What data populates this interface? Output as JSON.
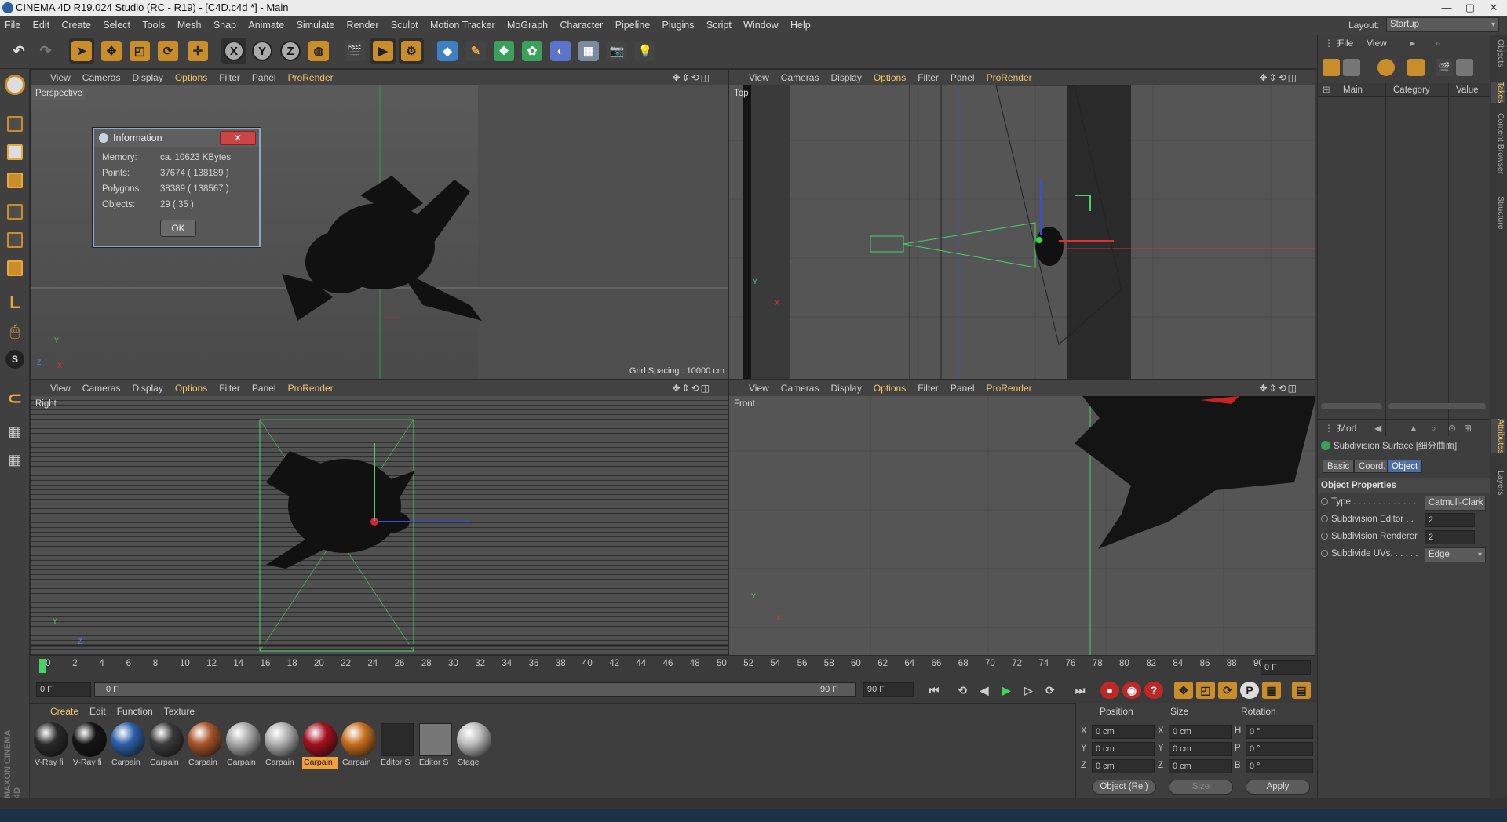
{
  "window": {
    "title": "CINEMA 4D R19.024 Studio (RC - R19) - [C4D.c4d *] - Main",
    "minimize": "—",
    "maximize": "▢",
    "close": "✕"
  },
  "menu": {
    "items": [
      "File",
      "Edit",
      "Create",
      "Select",
      "Tools",
      "Mesh",
      "Snap",
      "Animate",
      "Simulate",
      "Render",
      "Sculpt",
      "Motion Tracker",
      "MoGraph",
      "Character",
      "Pipeline",
      "Plugins",
      "Script",
      "Window",
      "Help"
    ]
  },
  "layout": {
    "label": "Layout:",
    "value": "Startup"
  },
  "toolbar": {
    "axis_x": "X",
    "axis_y": "Y",
    "axis_z": "Z"
  },
  "viewports": {
    "menu": [
      "View",
      "Cameras",
      "Display",
      "Options",
      "Filter",
      "Panel",
      "ProRender"
    ],
    "nav_icons": "✥⇕⟲◫",
    "perspective": {
      "name": "Perspective",
      "grid_spacing": "Grid Spacing : 10000 cm"
    },
    "top": {
      "name": "Top"
    },
    "right": {
      "name": "Right"
    },
    "front": {
      "name": "Front"
    },
    "axis_y": "Y",
    "axis_x": "X",
    "axis_z": "Z"
  },
  "info_dialog": {
    "title": "Information",
    "close_label": "✕",
    "rows": [
      {
        "key": "Memory:",
        "value": "ca. 10623 KBytes"
      },
      {
        "key": "Points:",
        "value": "37674 ( 138189 )"
      },
      {
        "key": "Polygons:",
        "value": "38389 ( 138567 )"
      },
      {
        "key": "Objects:",
        "value": "29 ( 35 )"
      }
    ],
    "ok_label": "OK"
  },
  "timeline": {
    "ticks": [
      "0",
      "2",
      "4",
      "6",
      "8",
      "10",
      "12",
      "14",
      "16",
      "18",
      "20",
      "22",
      "24",
      "26",
      "28",
      "30",
      "32",
      "34",
      "36",
      "38",
      "40",
      "42",
      "44",
      "46",
      "48",
      "50",
      "52",
      "54",
      "56",
      "58",
      "60",
      "62",
      "64",
      "66",
      "68",
      "70",
      "72",
      "74",
      "76",
      "78",
      "80",
      "82",
      "84",
      "86",
      "88",
      "90"
    ],
    "current_frame": "0 F",
    "start_frame": "0 F",
    "slider_start": "0 F",
    "slider_end": "90 F",
    "end_frame": "90 F"
  },
  "materials": {
    "menu": [
      "Create",
      "Edit",
      "Function",
      "Texture"
    ],
    "items": [
      {
        "label": "V-Ray fi",
        "color": "#2a2a2a"
      },
      {
        "label": "V-Ray fi",
        "color": "#151515"
      },
      {
        "label": "Carpain",
        "color": "#2d5fa8"
      },
      {
        "label": "Carpain",
        "color": "#3a3a3a"
      },
      {
        "label": "Carpain",
        "color": "#a8542a"
      },
      {
        "label": "Carpain",
        "color": "#a9a9a9"
      },
      {
        "label": "Carpain",
        "color": "#b0b0b0"
      },
      {
        "label": "Carpain",
        "color": "#a3101e"
      },
      {
        "label": "Carpain",
        "color": "#c8701e"
      },
      {
        "label": "Editor S",
        "color": "#2a2a2a"
      },
      {
        "label": "Editor S",
        "color": "#777777"
      },
      {
        "label": "Stage",
        "color": "#bdbdbd"
      }
    ],
    "selected_index": 7
  },
  "coords": {
    "headers": [
      "Position",
      "Size",
      "Rotation"
    ],
    "rows": [
      {
        "pos_axis": "X",
        "pos": "0 cm",
        "size_axis": "X",
        "size": "0 cm",
        "rot_axis": "H",
        "rot": "0 °"
      },
      {
        "pos_axis": "Y",
        "pos": "0 cm",
        "size_axis": "Y",
        "size": "0 cm",
        "rot_axis": "P",
        "rot": "0 °"
      },
      {
        "pos_axis": "Z",
        "pos": "0 cm",
        "size_axis": "Z",
        "size": "0 cm",
        "rot_axis": "B",
        "rot": "0 °"
      }
    ],
    "mode": "Object (Rel)",
    "size_mode": "Size",
    "apply": "Apply"
  },
  "object_manager": {
    "menu": [
      "File",
      "View"
    ],
    "columns": [
      "Main",
      "Category",
      "Value"
    ]
  },
  "attributes": {
    "mode_label": "Mod",
    "object_title": "Subdivision Surface [细分曲面]",
    "tabs": [
      "Basic",
      "Coord.",
      "Object"
    ],
    "active_tab": "Object",
    "section": "Object Properties",
    "props": [
      {
        "label": "Type . . . . . . . . . . . . .",
        "value": "Catmull-Clark"
      },
      {
        "label": "Subdivision Editor . .",
        "value": "2"
      },
      {
        "label": "Subdivision Renderer",
        "value": "2"
      },
      {
        "label": "Subdivide UVs. . . . . .",
        "value": "Edge"
      }
    ]
  },
  "side_tabs": [
    "Objects",
    "Takes",
    "Content Browser",
    "Structure",
    "Attributes",
    "Layers"
  ],
  "brand": "MAXON CINEMA 4D",
  "colors": {
    "accent": "#f2c46c",
    "selection": "#f0a13a",
    "green": "#46d16a"
  }
}
